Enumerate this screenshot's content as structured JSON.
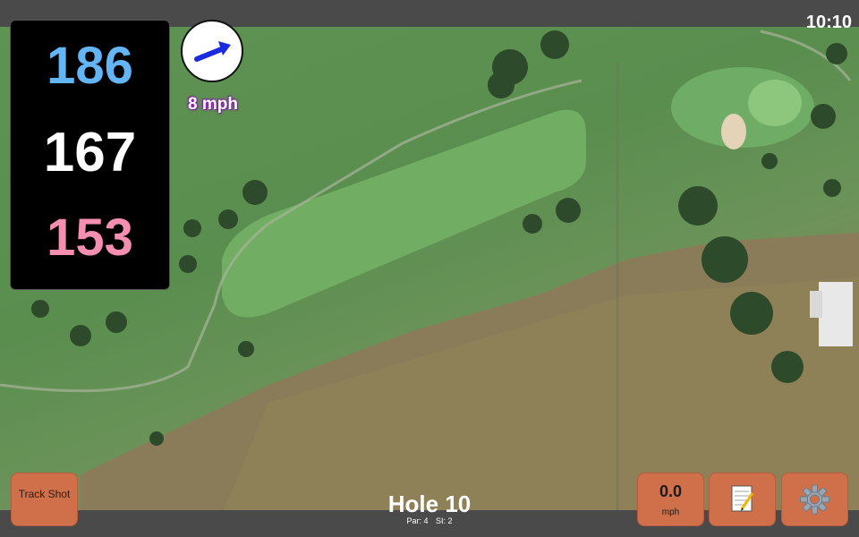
{
  "status_bar": {
    "time": "10:10"
  },
  "distances": {
    "back": "186",
    "middle": "167",
    "front": "153"
  },
  "wind": {
    "speed_label": "8 mph",
    "icon": "wind-arrow-icon",
    "direction": "east-northeast"
  },
  "hole": {
    "title": "Hole 10",
    "par_label": "Par: 4",
    "si_label": "SI: 2"
  },
  "buttons": {
    "track_shot": "Track Shot",
    "speed_value": "0.0",
    "speed_unit": "mph",
    "notes_icon": "notepad-icon",
    "settings_icon": "gear-icon"
  },
  "colors": {
    "back": "#64b5f6",
    "middle": "#ffffff",
    "front": "#f48fb1",
    "button": "#d0704a",
    "panel": "#000000",
    "wind_label_glow": "#8e24aa"
  }
}
